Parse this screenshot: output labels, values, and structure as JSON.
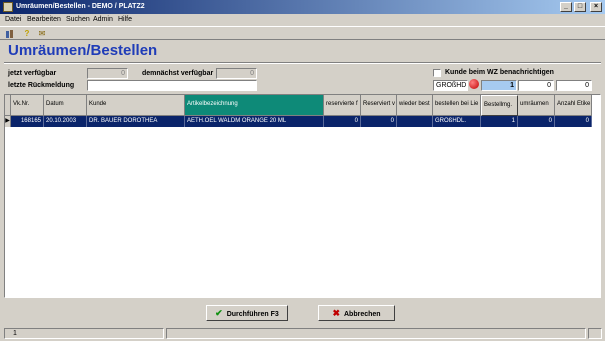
{
  "window": {
    "title": "Umräumen/Bestellen - DEMO / PLATZ2",
    "minimize": "_",
    "maximize": "□",
    "close": "×"
  },
  "menu": [
    "Datei",
    "Bearbeiten",
    "Suchen",
    "Admin",
    "Hilfe"
  ],
  "toolbar": {
    "icons": [
      "tools-icon",
      "help-icon",
      "mail-icon"
    ],
    "help_glyph": "?",
    "mail_glyph": "✉"
  },
  "heading": "Umräumen/Bestellen",
  "form": {
    "jetzt_label": "jetzt verfügbar",
    "jetzt_value": "0",
    "demnaechst_label": "demnächst verfügbar",
    "demnaechst_value": "0",
    "letzte_label": "letzte Rückmeldung",
    "letzte_value": "",
    "kunde_checkbox_label": "Kunde beim WZ benachrichtigen",
    "kunde_checked": false,
    "supplier_code": "GROßHD",
    "qty_1": "1",
    "qty_2": "0",
    "qty_3": "0"
  },
  "grid": {
    "columns": [
      "Vk.Nr.",
      "Datum",
      "Kunde",
      "Artikelbezeichnung",
      "reservierte f",
      "Reserviert v",
      "wieder best",
      "bestellen bei Lie",
      "Bestellmg.",
      "umräumen",
      "Anzahl Etike"
    ],
    "rows": [
      [
        "168165",
        "20.10.2003",
        "DR. BAUER DOROTHEA",
        "AETH.OEL WALDM ORANGE 20 ML",
        "0",
        "0",
        "",
        "GROßHDL.",
        "1",
        "0",
        "0"
      ]
    ],
    "row_indicator": "▶"
  },
  "buttons": {
    "execute": "Durchführen F3",
    "cancel": "Abbrechen",
    "execute_icon": "✔",
    "cancel_icon": "✖"
  },
  "status": {
    "pane1": "1"
  },
  "colors": {
    "title_blue": "#0a246a",
    "heading_blue": "#1f3cb8",
    "selected_header": "#0e8a78",
    "selected_row": "#0a246a"
  }
}
